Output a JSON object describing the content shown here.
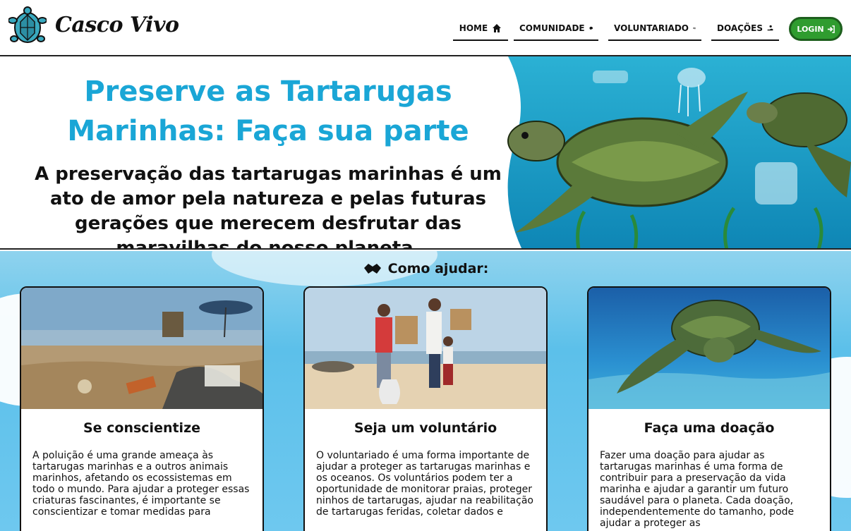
{
  "header": {
    "brand": "Casco Vivo",
    "nav": [
      {
        "label": "HOME",
        "icon": "home-icon"
      },
      {
        "label": "COMUNIDADE",
        "icon": "chat-bubble-icon"
      },
      {
        "label": "VOLUNTARIADO",
        "icon": "wave-icon"
      },
      {
        "label": "DOAÇÕES",
        "icon": "donation-hand-icon"
      }
    ],
    "login": "LOGIN",
    "login_icon": "sign-in-icon"
  },
  "hero": {
    "title": "Preserve as Tartarugas Marinhas: Faça sua parte",
    "body": "A preservação das tartarugas marinhas é um ato de amor pela natureza e pelas futuras gerações que merecem desfrutar das maravilhas do nosso planeta."
  },
  "help": {
    "title": "Como ajudar:",
    "icon": "handshake-icon",
    "cards": [
      {
        "title": "Se conscientize",
        "text": "A poluição é uma grande ameaça às tartarugas marinhas e a outros animais marinhos, afetando os ecossistemas em todo o mundo. Para ajudar a proteger essas criaturas fascinantes, é importante se conscientizar e tomar medidas para",
        "image": "polluted-beach-photo"
      },
      {
        "title": "Seja um voluntário",
        "text": "O voluntariado é uma forma importante de ajudar a proteger as tartarugas marinhas e os oceanos. Os voluntários podem ter a oportunidade de monitorar praias, proteger ninhos de tartarugas, ajudar na reabilitação de tartarugas feridas, coletar dados e",
        "image": "volunteers-beach-photo"
      },
      {
        "title": "Faça uma doação",
        "text": "Fazer uma doação para ajudar as tartarugas marinhas é uma forma de contribuir para a preservação da vida marinha e ajudar a garantir um futuro saudável para o planeta. Cada doação, independentemente do tamanho, pode ajudar a proteger as",
        "image": "sea-turtle-underwater-photo"
      }
    ]
  },
  "colors": {
    "accent": "#1aa6d6",
    "login_green": "#2f9c2f",
    "sky_blue": "#6ec8ef"
  }
}
